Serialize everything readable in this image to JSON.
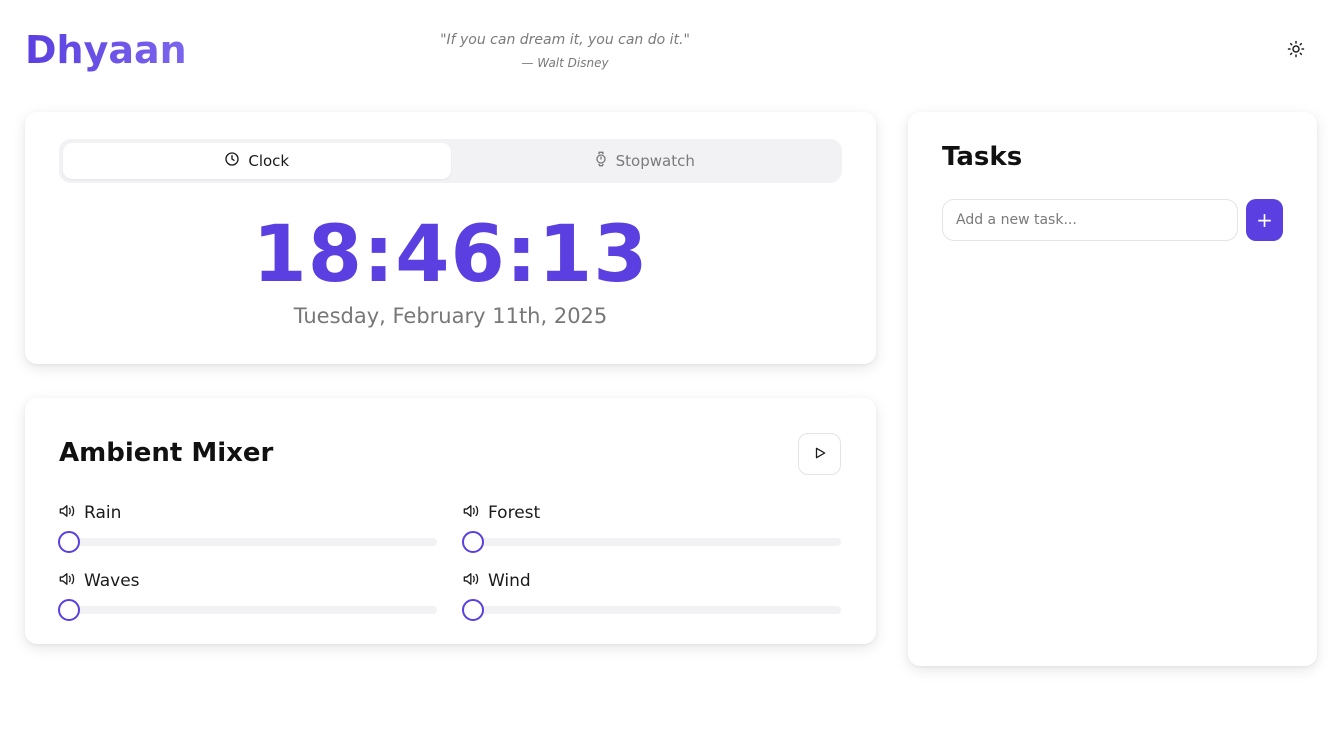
{
  "header": {
    "brand": "Dhyaan",
    "quote": "\"If you can dream it, you can do it.\"",
    "author": "— Walt Disney",
    "theme_icon": "sun-icon"
  },
  "clock": {
    "tabs": [
      {
        "label": "Clock",
        "icon": "clock-icon",
        "active": true
      },
      {
        "label": "Stopwatch",
        "icon": "stopwatch-icon",
        "active": false
      }
    ],
    "time": "18:46:13",
    "date": "Tuesday, February 11th, 2025"
  },
  "mixer": {
    "title": "Ambient Mixer",
    "play_icon": "play-icon",
    "sounds": [
      {
        "label": "Rain",
        "icon": "volume-icon",
        "level": 0
      },
      {
        "label": "Forest",
        "icon": "volume-icon",
        "level": 0
      },
      {
        "label": "Waves",
        "icon": "volume-icon",
        "level": 0
      },
      {
        "label": "Wind",
        "icon": "volume-icon",
        "level": 0
      }
    ]
  },
  "tasks": {
    "title": "Tasks",
    "input_placeholder": "Add a new task...",
    "input_value": "",
    "add_label": "+"
  },
  "colors": {
    "accent": "#5b3fe0",
    "muted_text": "#7a7a7a",
    "track": "#f2f2f4"
  }
}
